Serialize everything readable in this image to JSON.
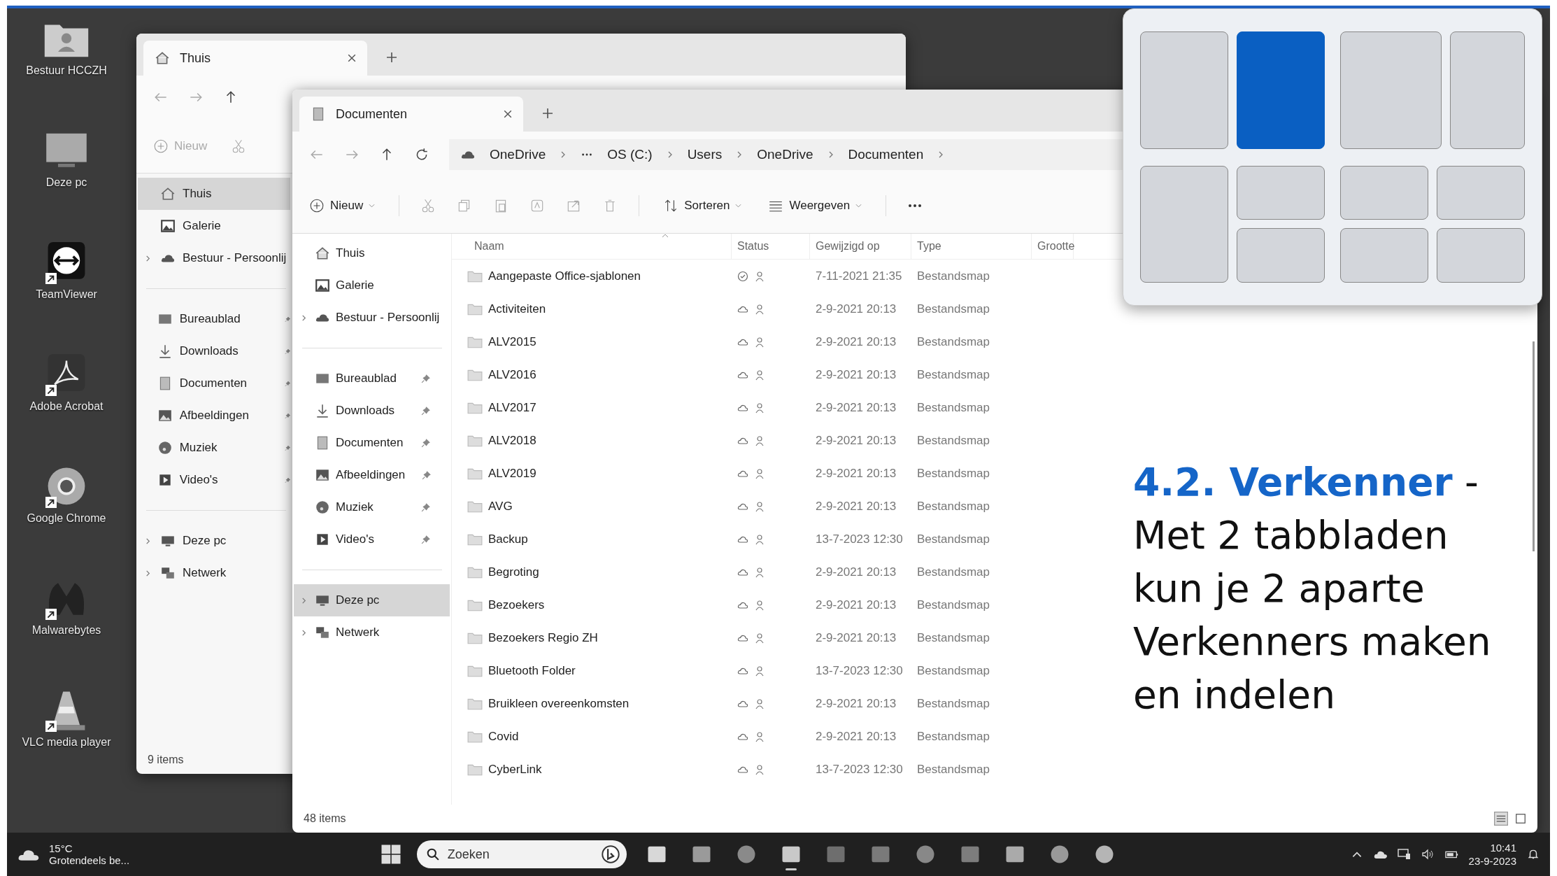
{
  "desktop_icons": [
    {
      "label": "Bestuur HCCZH",
      "kind": "user-folder",
      "shortcut": false
    },
    {
      "label": "Deze pc",
      "kind": "monitor",
      "shortcut": false
    },
    {
      "label": "TeamViewer",
      "kind": "teamviewer",
      "shortcut": true
    },
    {
      "label": "Adobe Acrobat",
      "kind": "acrobat",
      "shortcut": true
    },
    {
      "label": "Google Chrome",
      "kind": "chrome",
      "shortcut": true
    },
    {
      "label": "Malwarebytes",
      "kind": "malwarebytes",
      "shortcut": true
    },
    {
      "label": "VLC media player",
      "kind": "cone",
      "shortcut": true
    }
  ],
  "back_window": {
    "tabs": [
      {
        "label": "Thuis",
        "kind": "home",
        "selected": true
      }
    ],
    "toolbar": {
      "new_button": "Nieuw"
    },
    "sidebar": [
      [
        {
          "label": "Thuis",
          "kind": "home",
          "selected": true,
          "pinned": false,
          "expandable": false
        },
        {
          "label": "Galerie",
          "kind": "gallery",
          "selected": false,
          "pinned": false,
          "expandable": false
        },
        {
          "label": "Bestuur - Persoonlij",
          "kind": "cloud",
          "selected": false,
          "pinned": false,
          "expandable": true
        }
      ],
      [
        {
          "label": "Bureaublad",
          "kind": "desktop",
          "selected": false,
          "pinned": true,
          "expandable": false
        },
        {
          "label": "Downloads",
          "kind": "download",
          "selected": false,
          "pinned": true,
          "expandable": false
        },
        {
          "label": "Documenten",
          "kind": "document",
          "selected": false,
          "pinned": true,
          "expandable": false
        },
        {
          "label": "Afbeeldingen",
          "kind": "picture",
          "selected": false,
          "pinned": true,
          "expandable": false
        },
        {
          "label": "Muziek",
          "kind": "music",
          "selected": false,
          "pinned": true,
          "expandable": false
        },
        {
          "label": "Video's",
          "kind": "video",
          "selected": false,
          "pinned": true,
          "expandable": false
        }
      ],
      [
        {
          "label": "Deze pc",
          "kind": "pc",
          "selected": false,
          "pinned": false,
          "expandable": true
        },
        {
          "label": "Netwerk",
          "kind": "network",
          "selected": false,
          "pinned": false,
          "expandable": true
        }
      ]
    ],
    "status_bar": "9 items"
  },
  "front_window": {
    "tabs": [
      {
        "label": "Documenten",
        "kind": "document",
        "selected": true
      }
    ],
    "breadcrumb": [
      {
        "kind": "location",
        "label": "OneDrive"
      },
      {
        "kind": "overflow"
      },
      {
        "kind": "location",
        "label": "OS (C:)"
      },
      {
        "kind": "location",
        "label": "Users"
      },
      {
        "kind": "location",
        "label": "OneDrive"
      },
      {
        "kind": "location",
        "label": "Documenten"
      }
    ],
    "toolbar": {
      "new_button": "Nieuw",
      "sort_button": "Sorteren",
      "view_button": "Weergeven"
    },
    "sidebar": [
      [
        {
          "label": "Thuis",
          "kind": "home",
          "selected": false,
          "pinned": false,
          "expandable": false
        },
        {
          "label": "Galerie",
          "kind": "gallery",
          "selected": false,
          "pinned": false,
          "expandable": false
        },
        {
          "label": "Bestuur - Persoonlij",
          "kind": "cloud",
          "selected": false,
          "pinned": false,
          "expandable": true
        }
      ],
      [
        {
          "label": "Bureaublad",
          "kind": "desktop",
          "selected": false,
          "pinned": true,
          "expandable": false
        },
        {
          "label": "Downloads",
          "kind": "download",
          "selected": false,
          "pinned": true,
          "expandable": false
        },
        {
          "label": "Documenten",
          "kind": "document",
          "selected": false,
          "pinned": true,
          "expandable": false
        },
        {
          "label": "Afbeeldingen",
          "kind": "picture",
          "selected": false,
          "pinned": true,
          "expandable": false
        },
        {
          "label": "Muziek",
          "kind": "music",
          "selected": false,
          "pinned": true,
          "expandable": false
        },
        {
          "label": "Video's",
          "kind": "video",
          "selected": false,
          "pinned": true,
          "expandable": false
        }
      ],
      [
        {
          "label": "Deze pc",
          "kind": "pc",
          "selected": true,
          "pinned": false,
          "expandable": true
        },
        {
          "label": "Netwerk",
          "kind": "network",
          "selected": false,
          "pinned": false,
          "expandable": true
        }
      ]
    ],
    "table": {
      "columns": [
        "Naam",
        "Status",
        "Gewijzigd op",
        "Type",
        "Grootte"
      ],
      "rows": [
        {
          "name": "Aangepaste Office-sjablonen",
          "available_offline": true,
          "modified": "7-11-2021 21:35",
          "type": "Bestandsmap"
        },
        {
          "name": "Activiteiten",
          "available_offline": false,
          "modified": "2-9-2021 20:13",
          "type": "Bestandsmap"
        },
        {
          "name": "ALV2015",
          "available_offline": false,
          "modified": "2-9-2021 20:13",
          "type": "Bestandsmap"
        },
        {
          "name": "ALV2016",
          "available_offline": false,
          "modified": "2-9-2021 20:13",
          "type": "Bestandsmap"
        },
        {
          "name": "ALV2017",
          "available_offline": false,
          "modified": "2-9-2021 20:13",
          "type": "Bestandsmap"
        },
        {
          "name": "ALV2018",
          "available_offline": false,
          "modified": "2-9-2021 20:13",
          "type": "Bestandsmap"
        },
        {
          "name": "ALV2019",
          "available_offline": false,
          "modified": "2-9-2021 20:13",
          "type": "Bestandsmap"
        },
        {
          "name": "AVG",
          "available_offline": false,
          "modified": "2-9-2021 20:13",
          "type": "Bestandsmap"
        },
        {
          "name": "Backup",
          "available_offline": false,
          "modified": "13-7-2023 12:30",
          "type": "Bestandsmap"
        },
        {
          "name": "Begroting",
          "available_offline": false,
          "modified": "2-9-2021 20:13",
          "type": "Bestandsmap"
        },
        {
          "name": "Bezoekers",
          "available_offline": false,
          "modified": "2-9-2021 20:13",
          "type": "Bestandsmap"
        },
        {
          "name": "Bezoekers Regio ZH",
          "available_offline": false,
          "modified": "2-9-2021 20:13",
          "type": "Bestandsmap"
        },
        {
          "name": "Bluetooth Folder",
          "available_offline": false,
          "modified": "13-7-2023 12:30",
          "type": "Bestandsmap"
        },
        {
          "name": "Bruikleen overeenkomsten",
          "available_offline": false,
          "modified": "2-9-2021 20:13",
          "type": "Bestandsmap"
        },
        {
          "name": "Covid",
          "available_offline": false,
          "modified": "2-9-2021 20:13",
          "type": "Bestandsmap"
        },
        {
          "name": "CyberLink",
          "available_offline": false,
          "modified": "13-7-2023 12:30",
          "type": "Bestandsmap"
        }
      ]
    },
    "status_bar": "48 items"
  },
  "snap_layouts": [
    {
      "kind": "halves",
      "zones": [
        {
          "selected": false
        },
        {
          "selected": true
        }
      ]
    },
    {
      "kind": "wide-narrow",
      "zones": [
        {
          "selected": false
        },
        {
          "selected": false
        }
      ]
    },
    {
      "kind": "left-stack",
      "zones": [
        {
          "selected": false
        },
        {
          "selected": false
        },
        {
          "selected": false
        }
      ]
    },
    {
      "kind": "quad",
      "zones": [
        {
          "selected": false
        },
        {
          "selected": false
        },
        {
          "selected": false
        },
        {
          "selected": false
        }
      ]
    }
  ],
  "caption": "**4.2. Verkenner** - Met 2 tabbladen kun je 2 aparte Verkenners maken en indelen",
  "taskbar": {
    "weather": {
      "temperature": "15°C",
      "condition": "Grotendeels be..."
    },
    "search": {
      "placeholder": "Zoeken"
    },
    "apps": [
      {
        "kind": "window",
        "active": false
      },
      {
        "kind": "teams",
        "active": false
      },
      {
        "kind": "edge",
        "active": false
      },
      {
        "kind": "explorer",
        "active": true
      },
      {
        "kind": "onenote",
        "active": false
      },
      {
        "kind": "excel",
        "active": false
      },
      {
        "kind": "powerpoint",
        "active": false
      },
      {
        "kind": "word",
        "active": false
      },
      {
        "kind": "cloud",
        "active": false
      },
      {
        "kind": "spiral",
        "active": false
      },
      {
        "kind": "palette",
        "active": false
      }
    ],
    "clock": {
      "time": "10:41",
      "date": "23-9-2023"
    }
  }
}
